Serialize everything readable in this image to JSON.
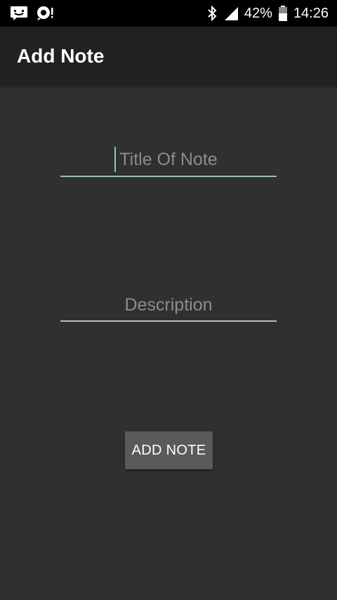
{
  "status_bar": {
    "battery": "42%",
    "time": "14:26",
    "icons": [
      "messenger-icon",
      "alert-icon",
      "bluetooth-icon",
      "signal-icon",
      "battery-icon"
    ]
  },
  "app_bar": {
    "title": "Add Note"
  },
  "form": {
    "title_placeholder": "Title Of Note",
    "title_value": "",
    "description_placeholder": "Description",
    "description_value": "",
    "submit_label": "ADD NOTE"
  },
  "colors": {
    "background": "#303030",
    "app_bar": "#212121",
    "accent": "#80cbc4",
    "button": "#5a5a5a"
  }
}
